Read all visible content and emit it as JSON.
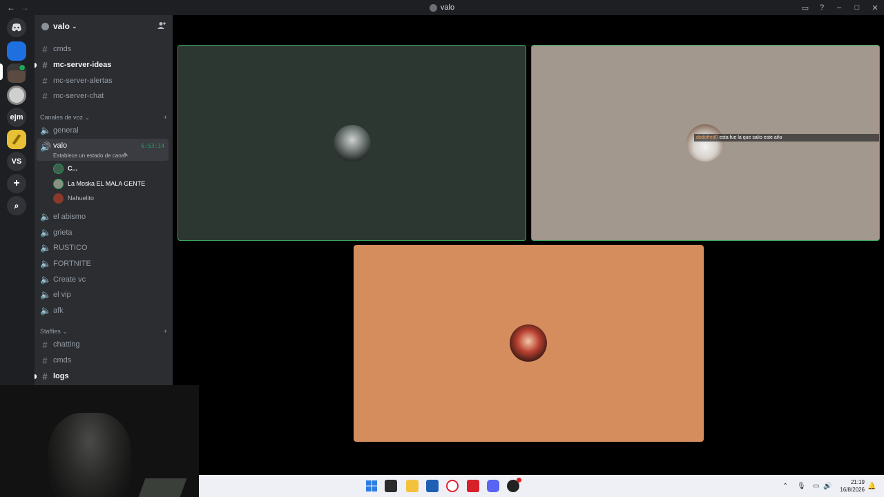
{
  "titlebar": {
    "back": "←",
    "forward": "→",
    "title": "valo"
  },
  "servers": {
    "items": [
      {
        "name": "ejm",
        "label": "ejm"
      },
      {
        "name": "vs",
        "label": "VS"
      }
    ],
    "add": "+",
    "explore": "⌕"
  },
  "guild": {
    "name": "valo"
  },
  "text_channels": [
    "cmds",
    "mc-server-ideas",
    "mc-server-alertas",
    "mc-server-chat"
  ],
  "voice_category": "Canales de voz",
  "active_voice": {
    "name": "valo",
    "timer": "6:53:14",
    "status": "Establece un estado de canal"
  },
  "voice_users": [
    "C...",
    "La Moska EL MALA GENTE",
    "Nahuelito"
  ],
  "voice_channels": [
    "general",
    "el abismo",
    "grieta",
    "RUSTICO",
    "FORTNITE",
    "Create vc",
    "el vip",
    "afk"
  ],
  "staff_category": "Staffies",
  "staff_channels": [
    "chatting",
    "cmds",
    "logs"
  ],
  "stream_caption": {
    "user": "dodofred0",
    "text": "esta fue la que salio este año"
  },
  "clock": {
    "time": "21:19",
    "date": "16/8/2026"
  },
  "colors": {
    "sidebar": "#2b2d31",
    "servers": "#1e1f22",
    "speaking": "#3ba55c",
    "tile1": "#2d3731",
    "tile2": "#a3988e",
    "tile3": "#d68d5e"
  }
}
